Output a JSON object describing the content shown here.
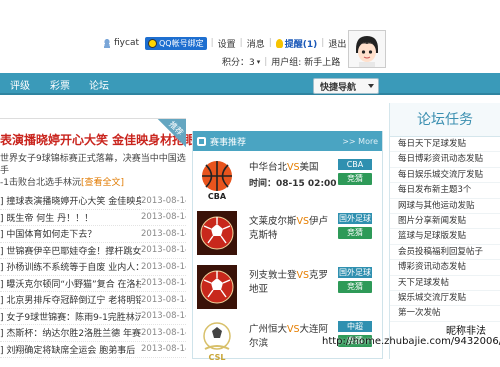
{
  "userbar": {
    "username": "fiycat",
    "qq_bind": "QQ帐号绑定",
    "settings": "设置",
    "messages": "消息",
    "reminder": "提醒(1)",
    "logout": "退出",
    "points_label": "积分：3",
    "user_group": "用户组: 新手上路"
  },
  "nav": {
    "items": [
      "评级",
      "彩票",
      "论坛"
    ],
    "quick_nav": "快捷导航"
  },
  "feature": {
    "title": "表演播晓婷开心大笑 金佳映身材抢眼",
    "corner_label": "推荐",
    "desc": "世界女子9球锦标赛正式落幕，决赛当中中国选手",
    "desc2": "-1击败台北选手林沅",
    "more": "[查看全文]"
  },
  "news": [
    {
      "title": "] 撞球表演播晓婷开心大笑 金佳映身",
      "date": "2013-08-14"
    },
    {
      "title": "] 既生帝 何生 丹！！！",
      "date": "2013-08-14"
    },
    {
      "title": "] 中国体育如何走下去？",
      "date": "2013-08-14"
    },
    {
      "title": "] 世锦赛伊辛巴耶娃夺金！撑杆跳女",
      "date": "2013-08-14"
    },
    {
      "title": "] 孙杨训练不系统等于自废 业内人：",
      "date": "2013-08-14"
    },
    {
      "title": "] 曝沃克尔顿同“小野猫”复合 在洛杉",
      "date": "2013-08-14"
    },
    {
      "title": "] 北京男排斥夺冠醉倒辽宁 老将明铝",
      "date": "2013-08-14"
    },
    {
      "title": "] 女子9球世锦赛：陈雨9-1完胜林沅",
      "date": "2013-08-14"
    },
    {
      "title": "] 杰斯杯：纳达尔胜2洛胜兰德 年赛事",
      "date": "2013-08-14"
    },
    {
      "title": "] 刘翔确定将缺席全运会 胞弟事后",
      "date": "2013-08-14"
    }
  ],
  "matches_panel": {
    "title": "赛事推荐",
    "more": ">> More",
    "matches": [
      {
        "home": "中华台北",
        "vs": "VS",
        "away": "美国",
        "time": "时间：08-15 02:00",
        "tag": "CBA",
        "button": "竞猜",
        "logo": "CBA"
      },
      {
        "home": "文莱皮尔斯",
        "vs": "VS",
        "away": "伊卢克斯特",
        "time": "",
        "tag": "国外足球",
        "button": "竞猜",
        "logo": "soccer-ball"
      },
      {
        "home": "列支敦士登",
        "vs": "VS",
        "away": "克罗地亚",
        "time": "",
        "tag": "国外足球",
        "button": "竞猜",
        "logo": "soccer-ball"
      },
      {
        "home": "广州恒大",
        "vs": "VS",
        "away": "大连阿尔滨",
        "time": "",
        "tag": "中超",
        "button": "竞猜",
        "logo": "CSL"
      }
    ]
  },
  "tasks_panel": {
    "title": "论坛任务",
    "items": [
      "每日天下足球发贴",
      "每日博彩资讯动态发贴",
      "每日娱乐城交流厅发贴",
      "每日发布新主题3个",
      "网球与其他运动发贴",
      "图片分享新闻发贴",
      "篮球与足球版发贴",
      "会员投稿福利回复帖子",
      "博彩资讯动态发帖",
      "天下足球发帖",
      "娱乐城交流厅发贴",
      "第一次发帖"
    ]
  },
  "watermark": {
    "line1": "昵称非法",
    "line2": "http://home.zhubajie.com/9432006/"
  },
  "colors": {
    "nav_bg": "#3a9ab9",
    "accent_red": "#c9241d",
    "vs_orange": "#e67e00",
    "guess_green": "#2e9a58"
  }
}
